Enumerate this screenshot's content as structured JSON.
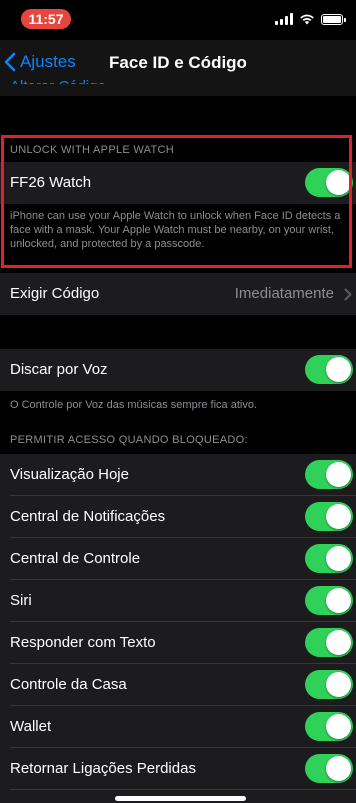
{
  "status": {
    "time": "11:57"
  },
  "nav": {
    "back_label": "Ajustes",
    "title": "Face ID e Código"
  },
  "clipped_row": "Alterar Código",
  "watch": {
    "header": "UNLOCK WITH APPLE WATCH",
    "label": "FF26 Watch",
    "toggle_on": true,
    "footer": "iPhone can use your Apple Watch to unlock when Face ID detects a face with a mask. Your Apple Watch must be nearby, on your wrist, unlocked, and protected by a passcode."
  },
  "require_code": {
    "label": "Exigir Código",
    "value": "Imediatamente"
  },
  "voice_dial": {
    "label": "Discar por Voz",
    "toggle_on": true,
    "footer": "O Controle por Voz das músicas sempre fica ativo."
  },
  "locked_access": {
    "header": "PERMITIR ACESSO QUANDO BLOQUEADO:",
    "items": [
      {
        "label": "Visualização Hoje",
        "on": true
      },
      {
        "label": "Central de Notificações",
        "on": true
      },
      {
        "label": "Central de Controle",
        "on": true
      },
      {
        "label": "Siri",
        "on": true
      },
      {
        "label": "Responder com Texto",
        "on": true
      },
      {
        "label": "Controle da Casa",
        "on": true
      },
      {
        "label": "Wallet",
        "on": true
      },
      {
        "label": "Retornar Ligações Perdidas",
        "on": true
      }
    ]
  },
  "colors": {
    "accent": "#0a84ff",
    "toggle_on": "#30d158",
    "highlight_border": "#e0212a",
    "status_pill": "#e6463d"
  }
}
